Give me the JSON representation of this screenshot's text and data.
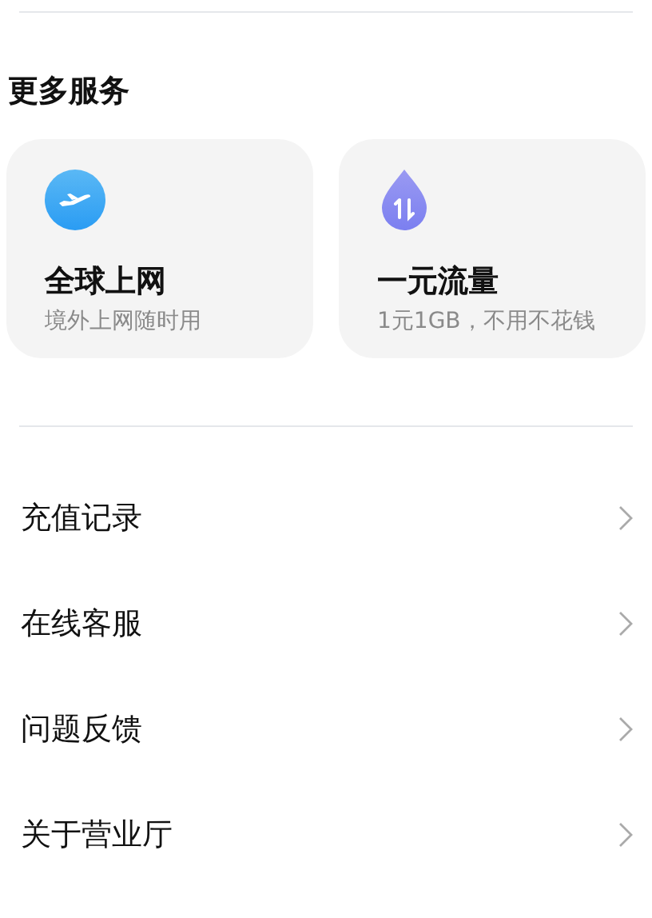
{
  "section_title": "更多服务",
  "services": [
    {
      "kind": "plane",
      "title": "全球上网",
      "subtitle": "境外上网随时用"
    },
    {
      "kind": "drop",
      "title": "一元流量",
      "subtitle": "1元1GB，不用不花钱"
    }
  ],
  "menu": [
    {
      "label": "充值记录"
    },
    {
      "label": "在线客服"
    },
    {
      "label": "问题反馈"
    },
    {
      "label": "关于营业厅"
    }
  ]
}
